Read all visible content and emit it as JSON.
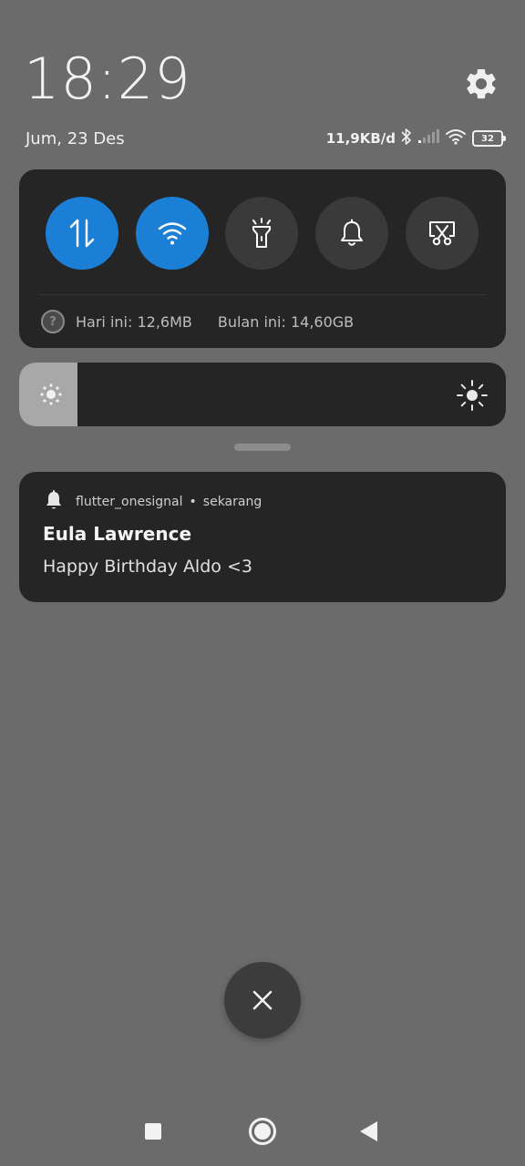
{
  "header": {
    "time": "18:29",
    "date": "Jum, 23 Des"
  },
  "status": {
    "net_speed": "11,9KB/d",
    "battery_level": "32"
  },
  "quick_settings": {
    "tiles": [
      {
        "name": "mobile-data",
        "icon": "data-arrows-icon",
        "active": true
      },
      {
        "name": "wifi",
        "icon": "wifi-icon",
        "active": true
      },
      {
        "name": "flashlight",
        "icon": "flashlight-icon",
        "active": false
      },
      {
        "name": "sound",
        "icon": "bell-icon",
        "active": false
      },
      {
        "name": "screenshot",
        "icon": "scissors-icon",
        "active": false
      }
    ],
    "usage_today": "Hari ini: 12,6MB",
    "usage_month": "Bulan ini: 14,60GB"
  },
  "brightness": {
    "level_fraction": 0.12
  },
  "notification": {
    "app": "flutter_onesignal",
    "separator": "•",
    "time": "sekarang",
    "title": "Eula Lawrence",
    "body": "Happy Birthday Aldo <3"
  },
  "colors": {
    "accent": "#1c7fd6",
    "panel": "#252525",
    "background": "#6b6b6b"
  }
}
